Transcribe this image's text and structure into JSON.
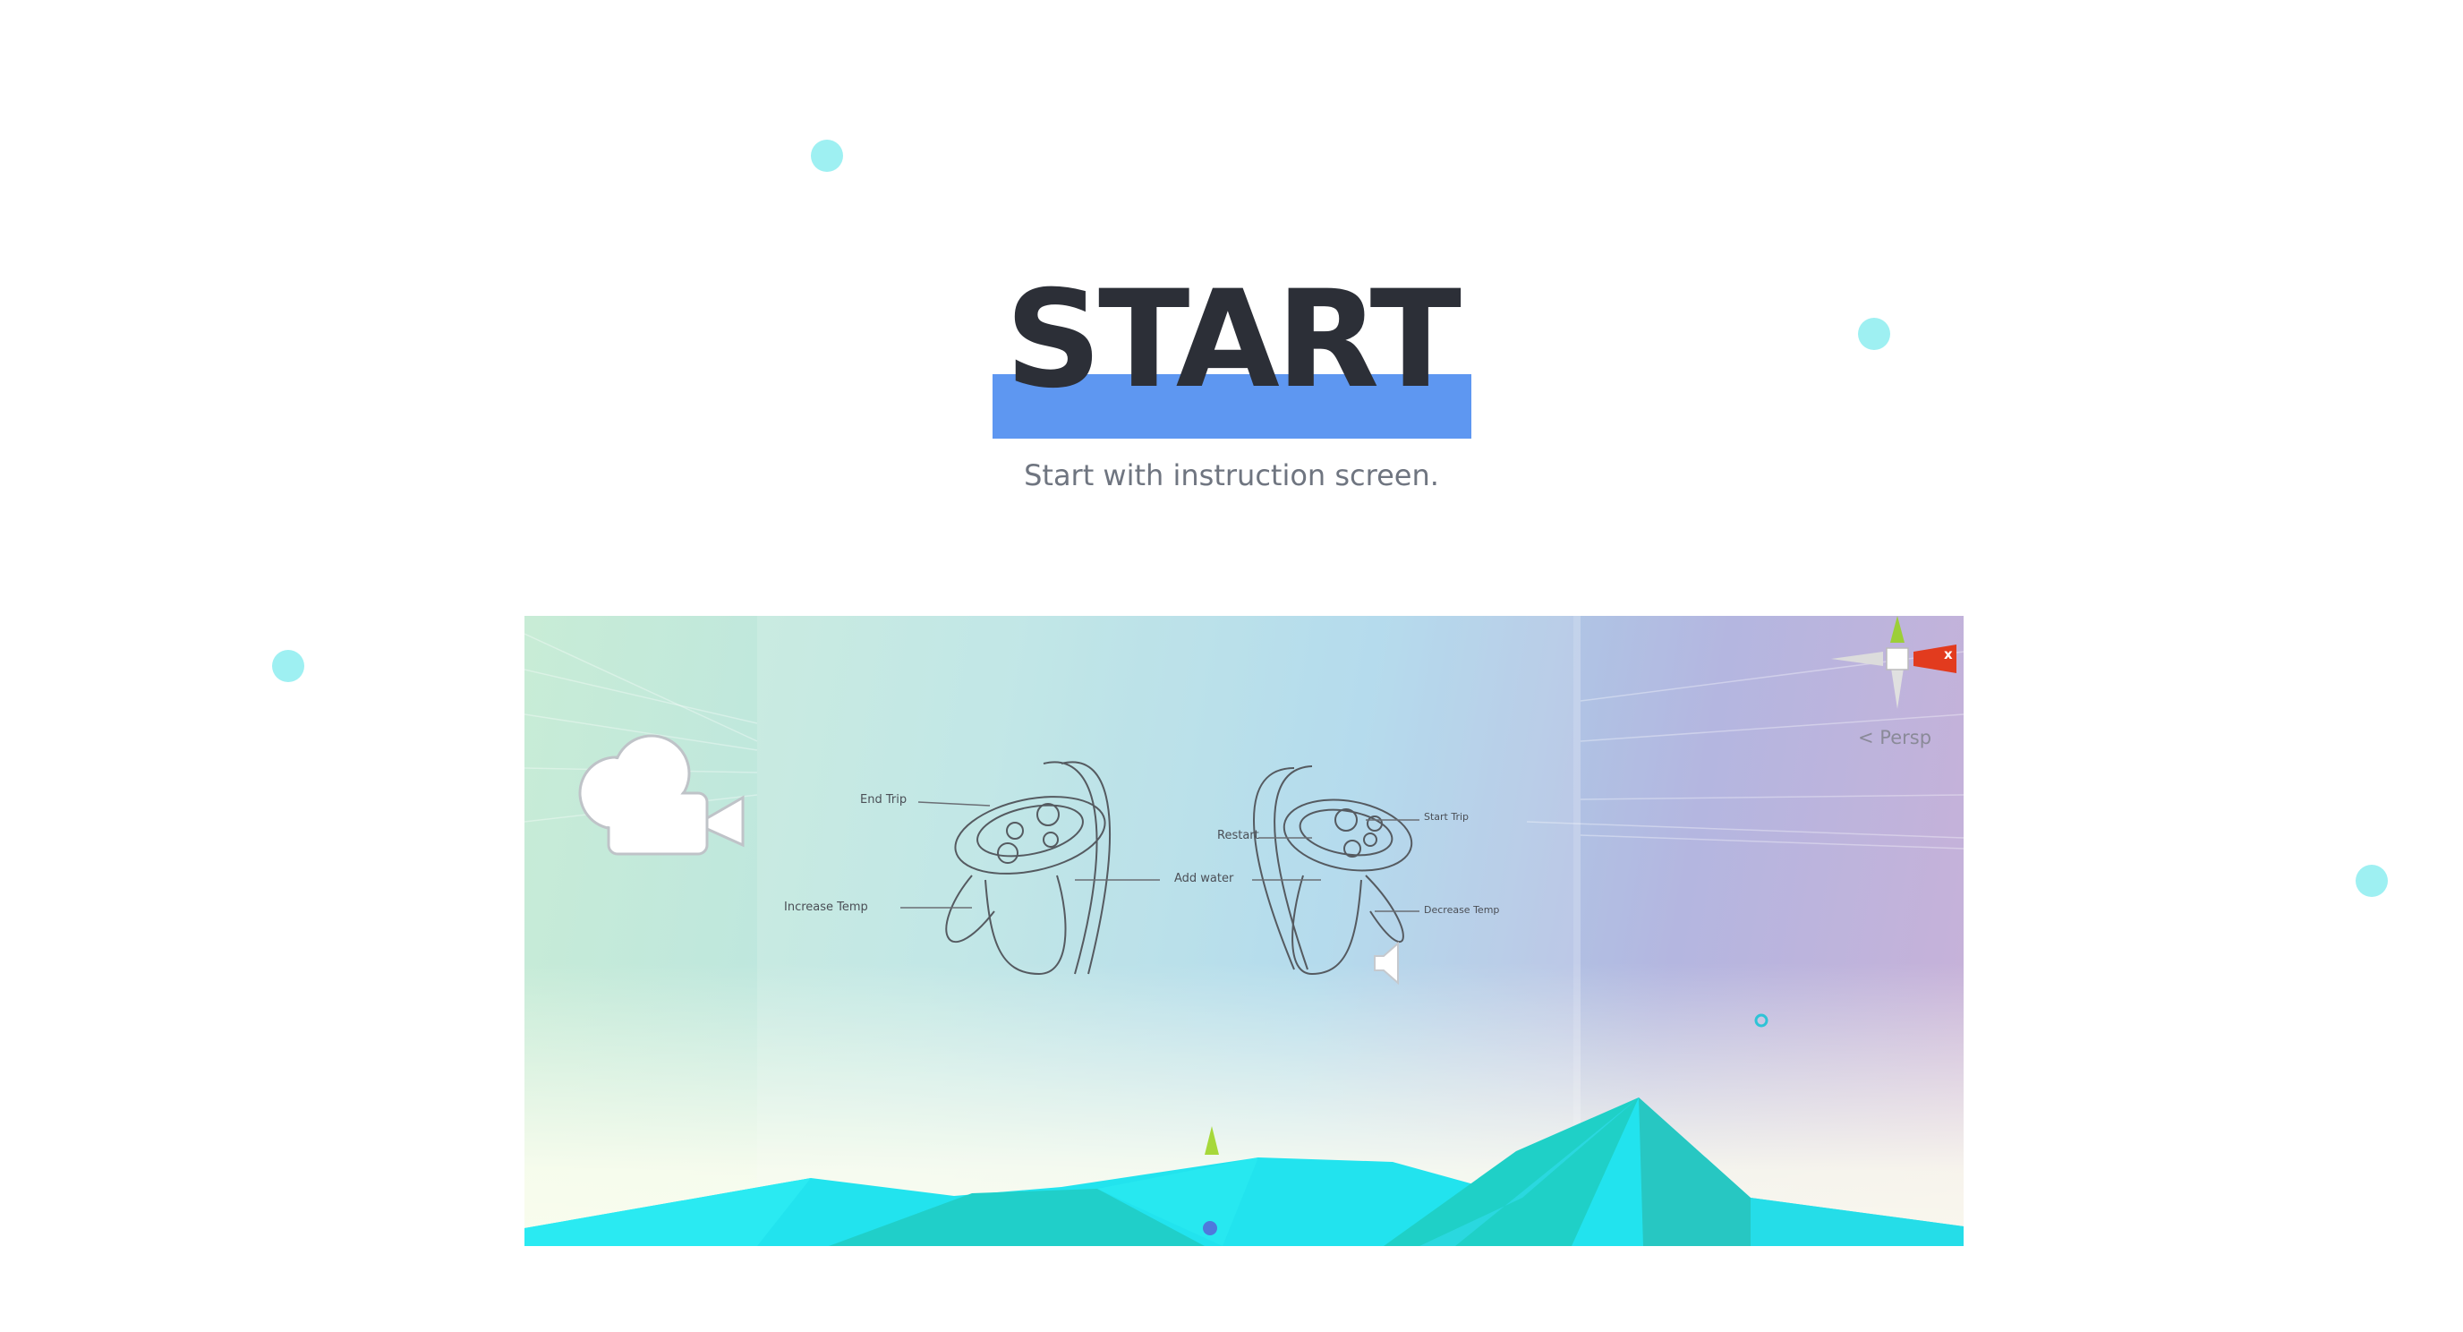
{
  "hero": {
    "title": "START",
    "subtitle": "Start with instruction screen."
  },
  "scene": {
    "labels": {
      "end_trip": "End Trip",
      "increase_temp": "Increase Temp",
      "add_water": "Add water",
      "restart": "Restart",
      "start_trip": "Start Trip",
      "decrease_temp": "Decrease Temp"
    },
    "gizmo": {
      "axis_x": "x",
      "projection": "Persp"
    },
    "icons": [
      "camera-icon",
      "audio-source-icon",
      "scene-gizmo-icon",
      "player-marker-icon"
    ]
  },
  "colors": {
    "accent_bar": "#5e97f1",
    "title": "#2c2f37",
    "dots": "#9ef0f2",
    "terrain": "#22e3ee"
  }
}
